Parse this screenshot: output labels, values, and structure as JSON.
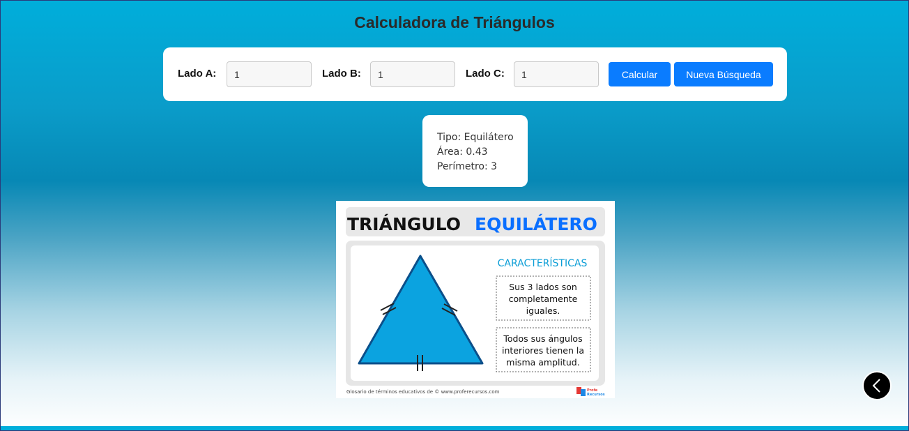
{
  "app": {
    "title": "Calculadora de Triángulos"
  },
  "form": {
    "fields": [
      {
        "label": "Lado A:",
        "value": "1"
      },
      {
        "label": "Lado B:",
        "value": "1"
      },
      {
        "label": "Lado C:",
        "value": "1"
      }
    ],
    "calculate_label": "Calcular",
    "new_search_label": "Nueva Búsqueda"
  },
  "result": {
    "type_text": "Tipo: Equilátero",
    "area_text": "Área: 0.43",
    "perimeter_text": "Perímetro: 3"
  },
  "infographic": {
    "title_black": "TRIÁNGULO",
    "title_blue": "EQUILÁTERO",
    "characteristics_heading": "CARACTERÍSTICAS",
    "box1_lines": [
      "Sus 3 lados son",
      "completamente",
      "iguales."
    ],
    "box2_lines": [
      "Todos sus ángulos",
      "interiores tienen la",
      "misma amplitud."
    ],
    "footer_text": "Glosario de términos educativos de © www.proferecursos.com",
    "logo_line1": "Profe",
    "logo_line2": "Recursos"
  },
  "nav": {
    "back_icon": "chevron-left-icon"
  },
  "colors": {
    "accent": "#0a7cff",
    "brand_blue": "#00aedb",
    "triangle_fill": "#0ba3e0"
  }
}
